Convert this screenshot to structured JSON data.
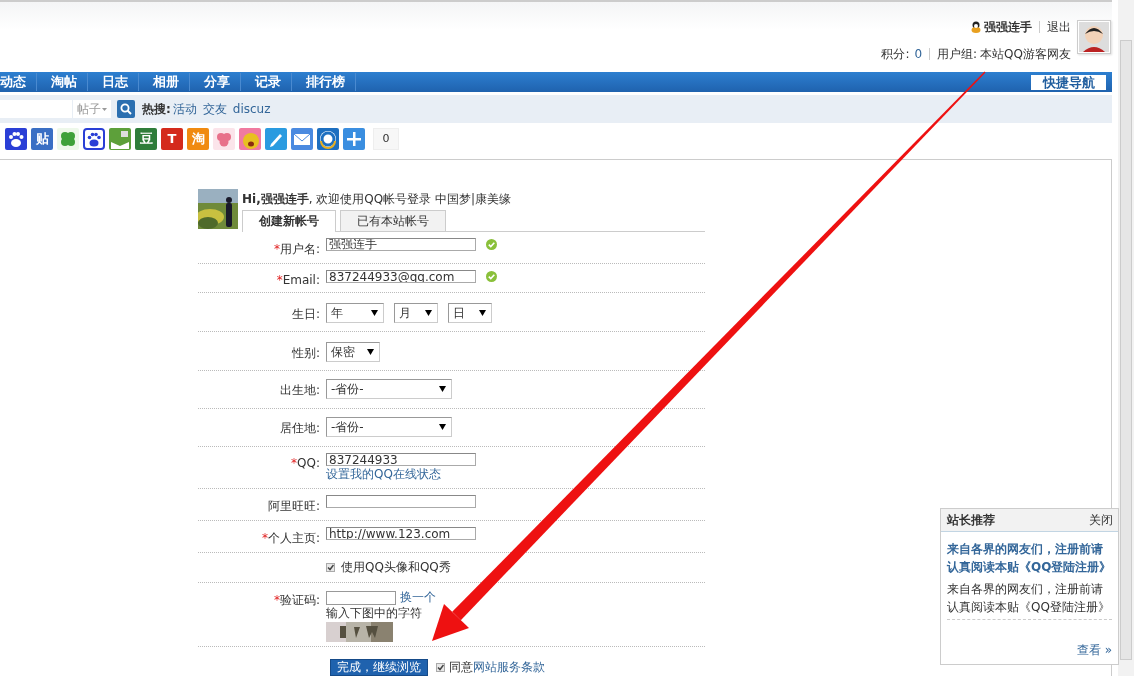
{
  "header": {
    "user": "强强连手",
    "logout": "退出",
    "points_label": "积分:",
    "points": "0",
    "group_label": "用户组:",
    "group": "本站QQ游客网友"
  },
  "nav": {
    "items": [
      "动态",
      "淘帖",
      "日志",
      "相册",
      "分享",
      "记录",
      "排行榜"
    ],
    "quick": "快捷导航"
  },
  "search": {
    "type": "帖子",
    "hot_label": "热搜:",
    "hot": [
      "活动",
      "交友",
      "discuz"
    ]
  },
  "share": {
    "icons": [
      {
        "kind": "paw",
        "color": "#2a3fd6"
      },
      {
        "kind": "tile",
        "label": "贴",
        "color": "#3a6fc4"
      },
      {
        "kind": "clover",
        "color": "#3fa13a"
      },
      {
        "kind": "paw-outline",
        "color": "#2a3fd6"
      },
      {
        "kind": "book",
        "color": "#5da03a"
      },
      {
        "kind": "tile",
        "label": "豆",
        "color": "#2f7d3a"
      },
      {
        "kind": "tile",
        "label": "T",
        "color": "#d42a1c"
      },
      {
        "kind": "tile",
        "label": "淘",
        "color": "#f08a10"
      },
      {
        "kind": "flower",
        "color": "#e8708a"
      },
      {
        "kind": "face",
        "color": "#e8c020"
      },
      {
        "kind": "pencil",
        "color": "#2a9be0"
      },
      {
        "kind": "mail",
        "color": "#4a8ae0"
      },
      {
        "kind": "ring",
        "color": "#1d6fc0"
      },
      {
        "kind": "plus",
        "color": "#3a8ee0"
      }
    ],
    "count": "0"
  },
  "form": {
    "greeting": "**Hi,强强连手**, 欢迎使用QQ帐号登录 中国梦|康美缘",
    "tabs": [
      {
        "label": "创建新帐号",
        "selected": true
      },
      {
        "label": "已有本站帐号",
        "selected": false
      }
    ],
    "rows": [
      {
        "kind": "input",
        "mark": "*",
        "label": "用户名:",
        "value": "强强连手",
        "valid": true
      },
      {
        "kind": "input",
        "mark": "*",
        "label": "Email:",
        "value": "837244933@qq.com",
        "valid": true
      },
      {
        "kind": "date",
        "label": "生日:",
        "options": [
          "年",
          "月",
          "日"
        ]
      },
      {
        "kind": "choice",
        "label": "性别:",
        "options": [
          "保密"
        ]
      },
      {
        "kind": "region",
        "label": "出生地:",
        "options": [
          "-省份-"
        ]
      },
      {
        "kind": "region",
        "label": "居住地:",
        "options": [
          "-省份-"
        ]
      },
      {
        "kind": "input",
        "mark": "*",
        "label": "QQ:",
        "value": "837244933",
        "link": "设置我的QQ在线状态"
      },
      {
        "kind": "input",
        "label": "阿里旺旺:"
      },
      {
        "kind": "input",
        "mark": "*",
        "label": "个人主页:",
        "value": "http://www.123.com"
      },
      {
        "kind": "check",
        "text": "使用QQ头像和QQ秀",
        "checked": true
      },
      {
        "kind": "captcha",
        "mark": "*",
        "label": "验证码:",
        "link": "换一个",
        "hint": "输入下图中的字符"
      }
    ],
    "submit": "完成，继续浏览",
    "agree": {
      "checked": true,
      "text": "同意",
      "link": "网站服务条款"
    }
  },
  "popup": {
    "title": "站长推荐",
    "close": "关闭",
    "headline": "来自各界的网友们，注册前请认真阅读本贴《QQ登陆注册》",
    "text": "来自各界的网友们，注册前请认真阅读本贴《QQ登陆注册》",
    "more": "查看 »"
  }
}
